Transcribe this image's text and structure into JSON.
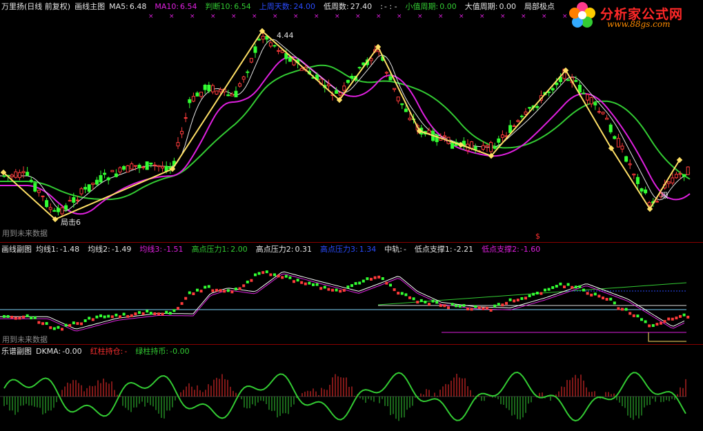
{
  "main": {
    "title": "万里扬(日线 前复权)",
    "indicator": "画线主图",
    "fields": [
      {
        "label": "MA5:",
        "value": "6.48",
        "color": "#e6e6e6"
      },
      {
        "label": "MA10:",
        "value": "6.54",
        "color": "#e020e0"
      },
      {
        "label": "判断10:",
        "value": "6.54",
        "color": "#33cc33"
      },
      {
        "label": "上周天数:",
        "value": "24.00",
        "color": "#2a4cff"
      },
      {
        "label": "低周数:",
        "value": "27.40",
        "color": "#e6e6e6"
      },
      {
        "label": ":",
        "value": "- : -",
        "color": "#e6e6e6"
      },
      {
        "label": "小值周期:",
        "value": "0.00",
        "color": "#33cc33"
      },
      {
        "label": "大值周期:",
        "value": "0.00",
        "color": "#e6e6e6"
      },
      {
        "label": "局部极点",
        "value": "",
        "color": "#e6e6e6"
      }
    ],
    "note": "用到未来数据",
    "annotations": {
      "peak": "4.44",
      "low_left": "局击6",
      "low_right": "吸",
      "dollar": "$"
    }
  },
  "sub": {
    "indicator": "画线副图",
    "fields": [
      {
        "label": "均线1:",
        "value": "-1.48",
        "color": "#e6e6e6"
      },
      {
        "label": "均线2:",
        "value": "-1.49",
        "color": "#e6e6e6"
      },
      {
        "label": "均线3:",
        "value": "-1.51",
        "color": "#e020e0"
      },
      {
        "label": "高点压力1:",
        "value": "2.00",
        "color": "#33cc33"
      },
      {
        "label": "高点压力2:",
        "value": "0.31",
        "color": "#e6e6e6"
      },
      {
        "label": "高点压力3:",
        "value": "1.34",
        "color": "#2a4cff"
      },
      {
        "label": "中轨:",
        "value": "-",
        "color": "#e6e6e6"
      },
      {
        "label": "低点支撑1:",
        "value": "-2.21",
        "color": "#e6e6e6"
      },
      {
        "label": "低点支撑2:",
        "value": "-1.60",
        "color": "#e020e0"
      }
    ],
    "note": "用到未来数据"
  },
  "osc": {
    "indicator": "乐谱副图",
    "fields": [
      {
        "label": "DKMA:",
        "value": "-0.00",
        "color": "#e6e6e6"
      },
      {
        "label": "红柱持仓:",
        "value": "-",
        "color": "#ff3030"
      },
      {
        "label": "绿柱持币:",
        "value": "-0.00",
        "color": "#33cc33"
      }
    ]
  },
  "logo": {
    "title": "分析家公式网",
    "url": "www.88gs.com"
  },
  "chart_data": {
    "type": "line",
    "series": [
      {
        "name": "MA5",
        "color": "#e6e6e6"
      },
      {
        "name": "MA10",
        "color": "#e020e0"
      },
      {
        "name": "判断10",
        "color": "#33cc33"
      }
    ]
  }
}
